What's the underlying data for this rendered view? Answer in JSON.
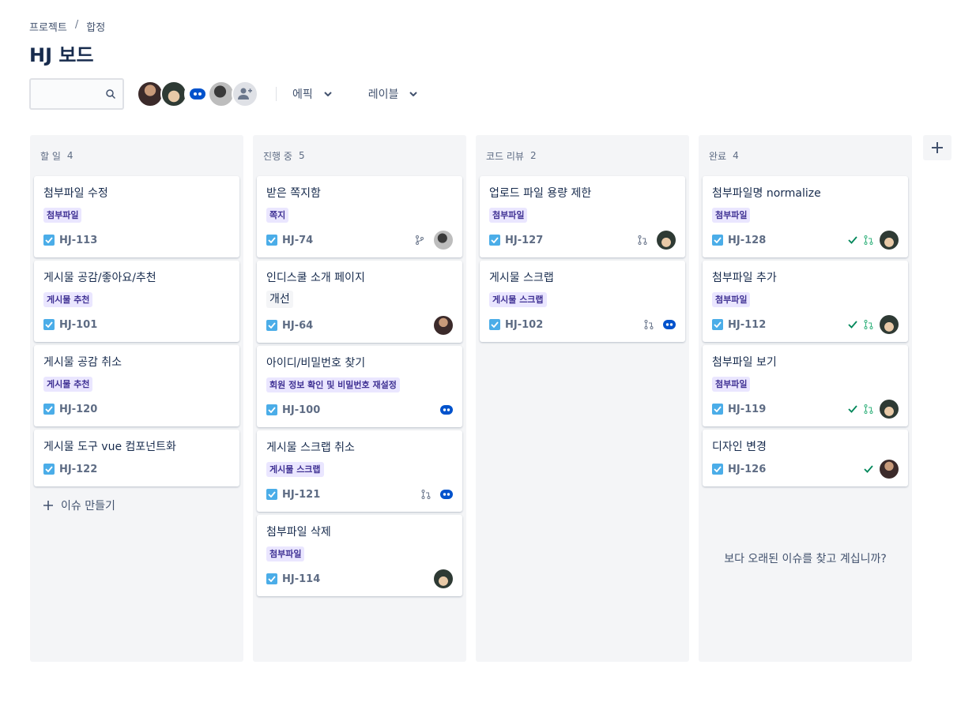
{
  "breadcrumb": {
    "project": "프로젝트",
    "separator": "/",
    "current": "합정"
  },
  "title": "HJ 보드",
  "search": {
    "placeholder": ""
  },
  "filters": {
    "epic": "에픽",
    "label": "레이블"
  },
  "colors": {
    "accent": "#0052cc",
    "label_bg": "#eae6ff",
    "label_text": "#403294",
    "check": "#4bade8",
    "done_green": "#36b37e"
  },
  "columns": [
    {
      "name": "할 일",
      "count": "4",
      "cards": [
        {
          "title": "첨부파일 수정",
          "label": "첨부파일",
          "key": "HJ-113"
        },
        {
          "title": "게시물 공감/좋아요/추천",
          "label": "게시물 추천",
          "key": "HJ-101"
        },
        {
          "title": "게시물 공감 취소",
          "label": "게시물 추천",
          "key": "HJ-120"
        },
        {
          "title": "게시물 도구 vue 컴포넌트화",
          "key": "HJ-122"
        }
      ],
      "create_label": "이슈 만들기"
    },
    {
      "name": "진행 중",
      "count": "5",
      "cards": [
        {
          "title": "받은 쪽지함",
          "label": "쪽지",
          "key": "HJ-74",
          "icons": [
            "branch-icon",
            "avatar"
          ]
        },
        {
          "title": "인디스쿨 소개 페이지",
          "label": "개선",
          "key": "HJ-64",
          "icons": [
            "avatar"
          ]
        },
        {
          "title": "아이디/비밀번호 찾기",
          "label": "회원 정보 확인 및 비밀번호 재설정",
          "key": "HJ-100",
          "icons": [
            "bot-avatar"
          ]
        },
        {
          "title": "게시물 스크랩 취소",
          "label": "게시물 스크랩",
          "key": "HJ-121",
          "icons": [
            "pull-request-icon",
            "bot-avatar"
          ]
        },
        {
          "title": "첨부파일 삭제",
          "label": "첨부파일",
          "key": "HJ-114",
          "icons": [
            "avatar"
          ]
        }
      ]
    },
    {
      "name": "코드 리뷰",
      "count": "2",
      "cards": [
        {
          "title": "업로드 파일 용량 제한",
          "label": "첨부파일",
          "key": "HJ-127",
          "icons": [
            "pull-request-icon",
            "avatar"
          ]
        },
        {
          "title": "게시물 스크랩",
          "label": "게시물 스크랩",
          "key": "HJ-102",
          "icons": [
            "pull-request-icon",
            "bot-avatar"
          ]
        }
      ]
    },
    {
      "name": "완료",
      "count": "4",
      "cards": [
        {
          "title": "첨부파일명 normalize",
          "label": "첨부파일",
          "key": "HJ-128",
          "icons": [
            "done-check-icon",
            "merged-icon",
            "avatar"
          ]
        },
        {
          "title": "첨부파일 추가",
          "label": "첨부파일",
          "key": "HJ-112",
          "icons": [
            "done-check-icon",
            "merged-icon",
            "avatar"
          ]
        },
        {
          "title": "첨부파일 보기",
          "label": "첨부파일",
          "key": "HJ-119",
          "icons": [
            "done-check-icon",
            "merged-icon",
            "avatar"
          ]
        },
        {
          "title": "디자인 변경",
          "key": "HJ-126",
          "icons": [
            "done-check-icon",
            "avatar"
          ]
        }
      ],
      "older_text": "보다 오래된 이슈를 찾고 계십니까?"
    }
  ]
}
